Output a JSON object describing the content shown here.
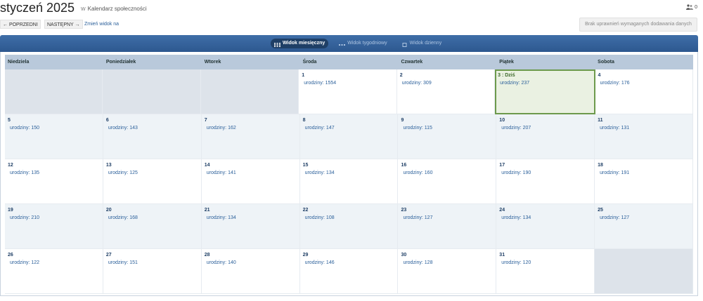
{
  "header": {
    "title": "styczeń 2025",
    "subtitle_prefix": "W",
    "subtitle": "Kalendarz społeczności",
    "users_count": "0"
  },
  "nav": {
    "prev": "← POPRZEDNI",
    "next": "NASTĘPNY →",
    "change_view": "Zmień widok na"
  },
  "no_permission": "Brak uprawnień wymaganych dodawania danych",
  "views": [
    {
      "label": "Widok miesięczny",
      "active": true
    },
    {
      "label": "Widok tygodniowy",
      "active": false
    },
    {
      "label": "Widok dzienny",
      "active": false
    }
  ],
  "weekdays": [
    "Niedziela",
    "Poniedziałek",
    "Wtorek",
    "Środa",
    "Czwartek",
    "Piątek",
    "Sobota"
  ],
  "today_label": "3 : Dziś",
  "event_prefix": "urodziny:",
  "weeks": [
    [
      null,
      null,
      null,
      {
        "day": "1",
        "count": "1554"
      },
      {
        "day": "2",
        "count": "309"
      },
      {
        "day": "3",
        "count": "237",
        "today": true
      },
      {
        "day": "4",
        "count": "176"
      }
    ],
    [
      {
        "day": "5",
        "count": "150"
      },
      {
        "day": "6",
        "count": "143"
      },
      {
        "day": "7",
        "count": "162"
      },
      {
        "day": "8",
        "count": "147"
      },
      {
        "day": "9",
        "count": "115"
      },
      {
        "day": "10",
        "count": "207"
      },
      {
        "day": "11",
        "count": "131"
      }
    ],
    [
      {
        "day": "12",
        "count": "135"
      },
      {
        "day": "13",
        "count": "125"
      },
      {
        "day": "14",
        "count": "141"
      },
      {
        "day": "15",
        "count": "134"
      },
      {
        "day": "16",
        "count": "160"
      },
      {
        "day": "17",
        "count": "190"
      },
      {
        "day": "18",
        "count": "191"
      }
    ],
    [
      {
        "day": "19",
        "count": "210"
      },
      {
        "day": "20",
        "count": "168"
      },
      {
        "day": "21",
        "count": "134"
      },
      {
        "day": "22",
        "count": "108"
      },
      {
        "day": "23",
        "count": "127"
      },
      {
        "day": "24",
        "count": "134"
      },
      {
        "day": "25",
        "count": "127"
      }
    ],
    [
      {
        "day": "26",
        "count": "122"
      },
      {
        "day": "27",
        "count": "151"
      },
      {
        "day": "28",
        "count": "140"
      },
      {
        "day": "29",
        "count": "146"
      },
      {
        "day": "30",
        "count": "128"
      },
      {
        "day": "31",
        "count": "120"
      },
      null
    ]
  ]
}
